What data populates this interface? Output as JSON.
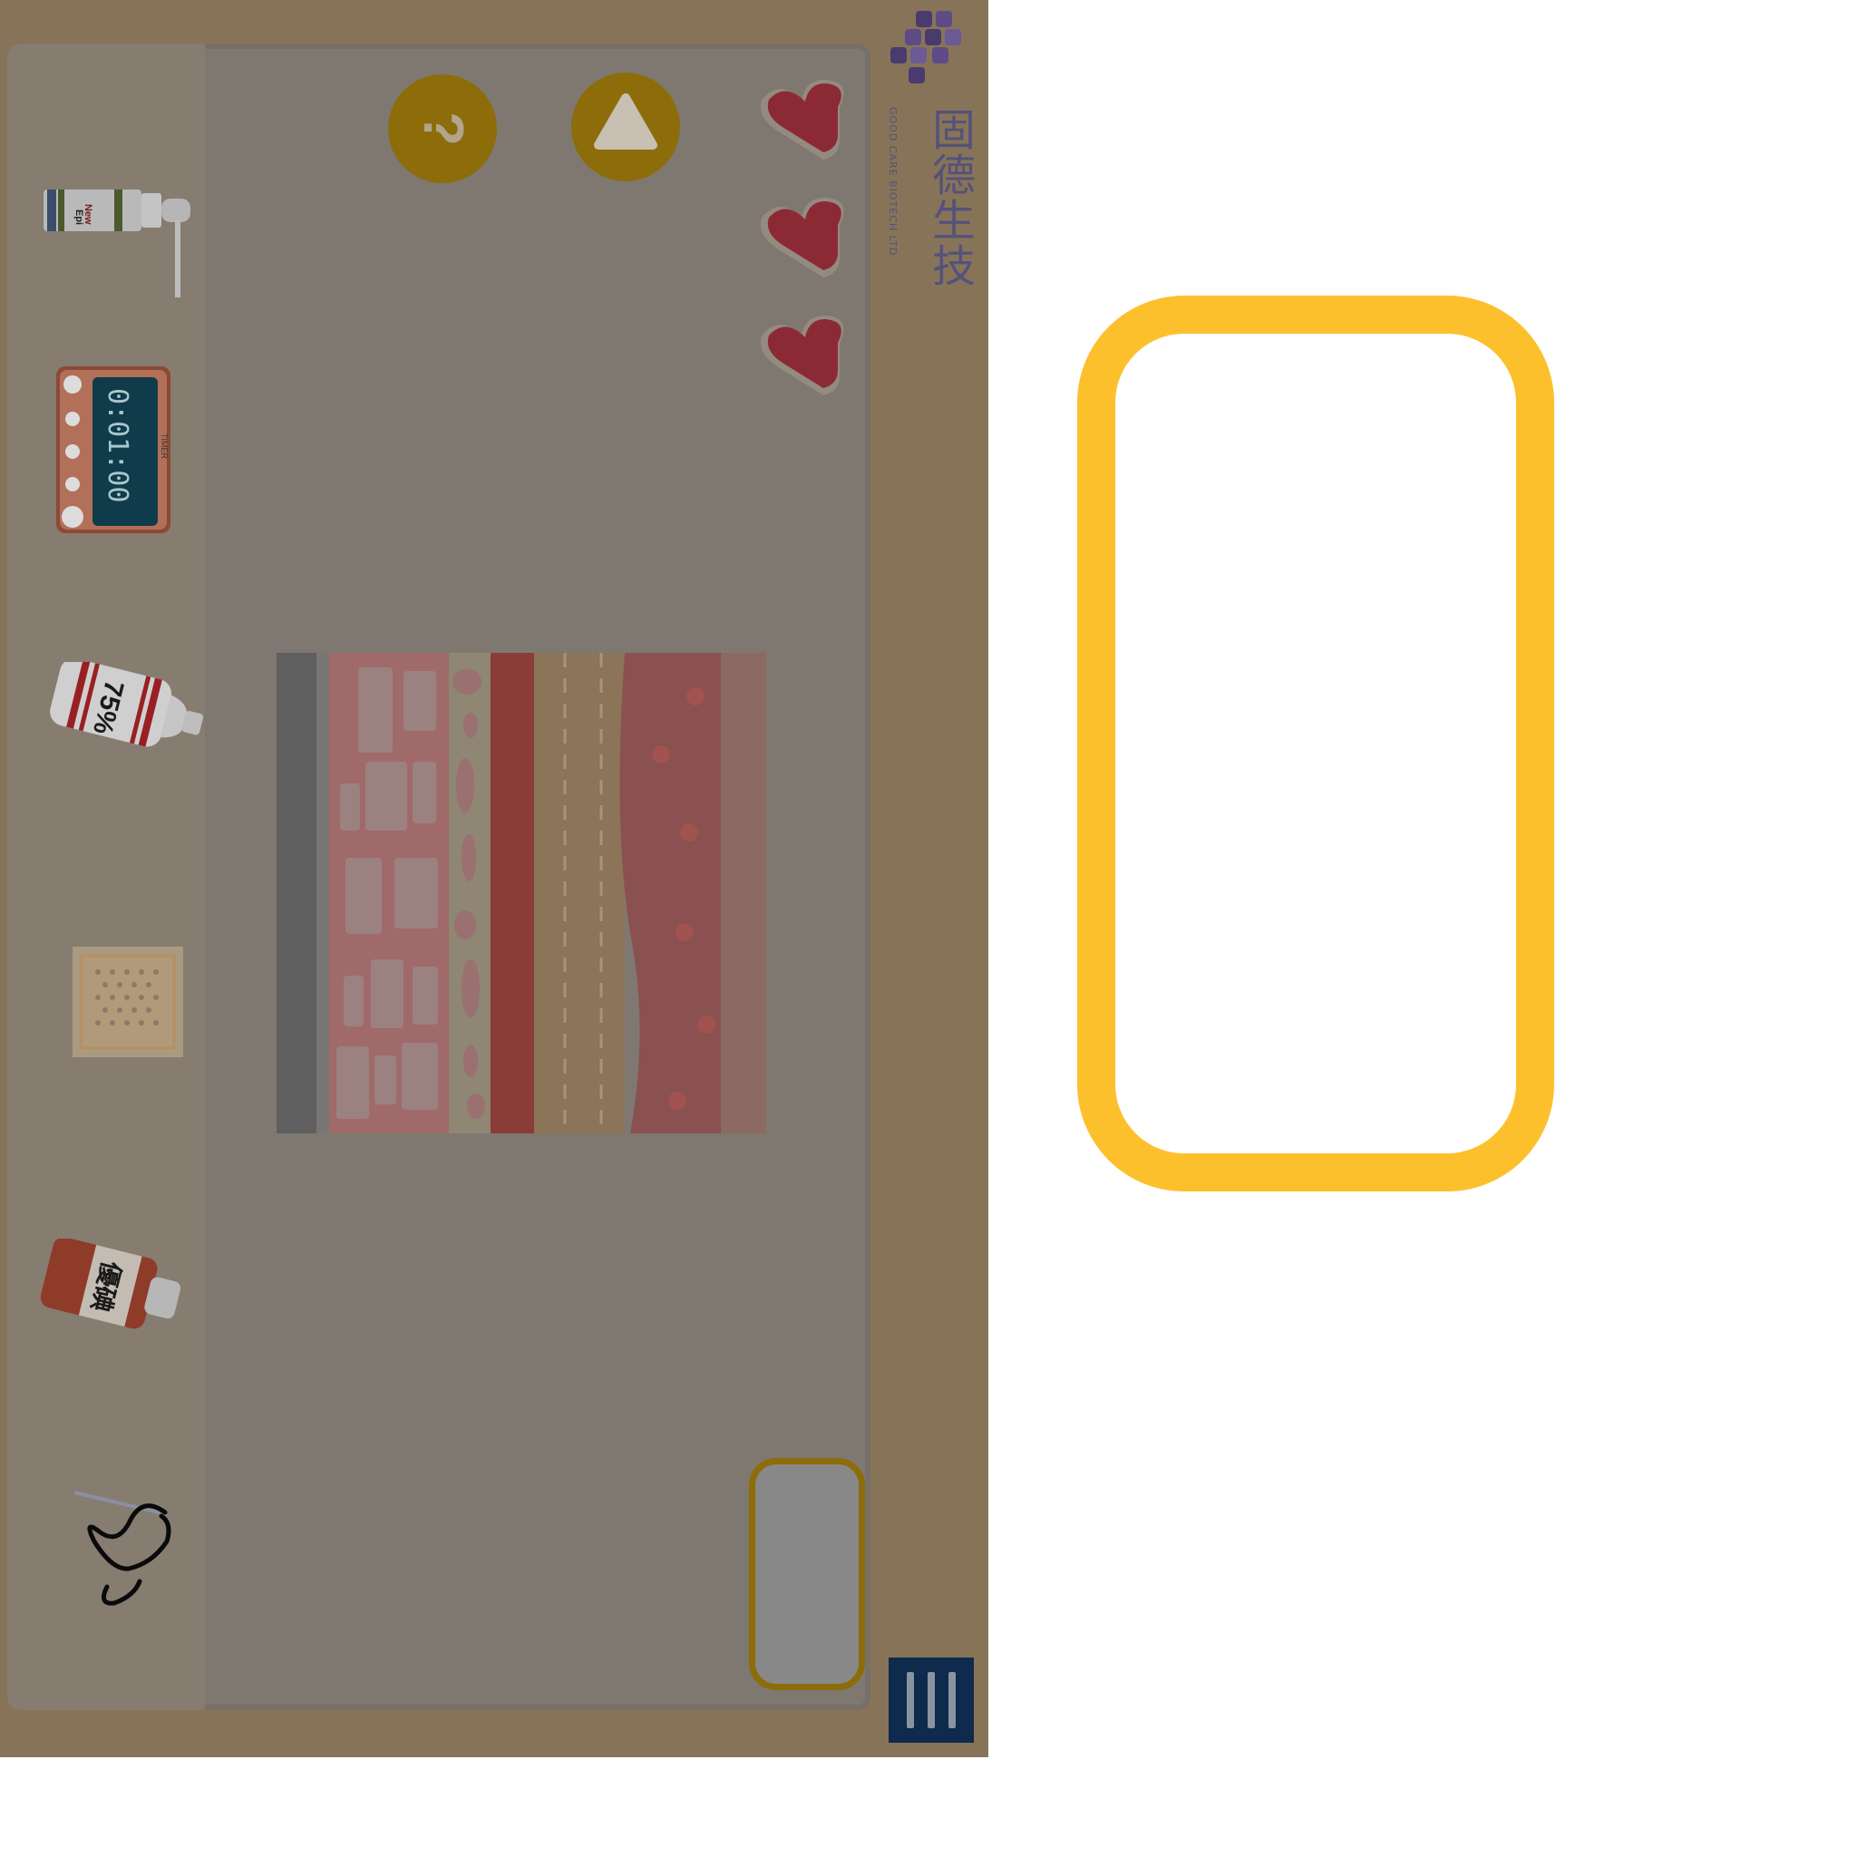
{
  "brand": {
    "name": "固德生技",
    "subtitle": "GOOD CARE BIOTECH LTD."
  },
  "hud": {
    "lives_remaining": 3,
    "lives_max": 3,
    "help_label": "?",
    "play_icon": "triangle-icon",
    "menu_icon": "menu-bars-icon"
  },
  "tools": {
    "spray_label_line1": "New",
    "spray_label_line2": "Epi",
    "timer_caption": "TIMER",
    "timer_value": "0:01:00",
    "alcohol_label": "75%",
    "patch_icon": "gauze-patch-icon",
    "iodine_label": "優碘",
    "suture_icon": "suture-needle-icon"
  },
  "colors": {
    "frame": "#877458",
    "panel": "#7f7870",
    "accent_gold": "#8d6c0a",
    "slot_highlight": "#fdc02d",
    "heart": "#8b2a35",
    "menu": "#0e2a4c"
  }
}
